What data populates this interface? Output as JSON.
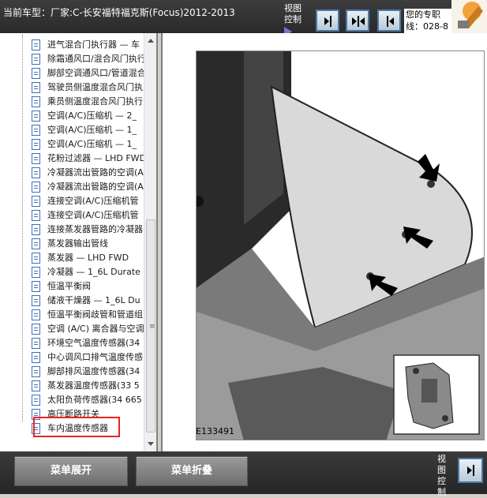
{
  "header": {
    "car_type": "当前车型：厂家:C-长安福特福克斯(Focus)2012-2013",
    "view_control": "视图控制",
    "promo_line1": "您的专职",
    "promo_line2": "线：028-8"
  },
  "tree": {
    "items": [
      "进气混合门执行器 — 车",
      "除霜通风口/混合风门执行",
      "脚部空调通风口/管道混合",
      "驾驶员侧温度混合风门执",
      "乘员侧温度混合风门执行",
      "空调(A/C)压缩机 — 2_",
      "空调(A/C)压缩机 — 1_",
      "空调(A/C)压缩机 — 1_",
      "花粉过滤器 — LHD FWD",
      "冷凝器流出管路的空调(A",
      "冷凝器流出管路的空调(A",
      "连接空调(A/C)压缩机管",
      "连接空调(A/C)压缩机管",
      "连接蒸发器管路的冷凝器",
      "蒸发器输出管线",
      "蒸发器 — LHD FWD",
      "冷凝器 — 1_6L Durate",
      "恒温平衡阀",
      "储液干燥器 — 1_6L Du",
      "恒温平衡阀歧管和管道组",
      "空调 (A/C) 离合器与空调",
      "环境空气温度传感器(34",
      "中心调风口排气温度传感",
      "脚部排风温度传感器(34",
      "蒸发器温度传感器(33 5",
      "太阳负荷传感器(34 665",
      "高压断路开关",
      "车内温度传感器"
    ]
  },
  "figure": {
    "id_label": "E133491"
  },
  "footer": {
    "expand_label": "菜单展开",
    "collapse_label": "菜单折叠",
    "view_control": "视图控制"
  }
}
